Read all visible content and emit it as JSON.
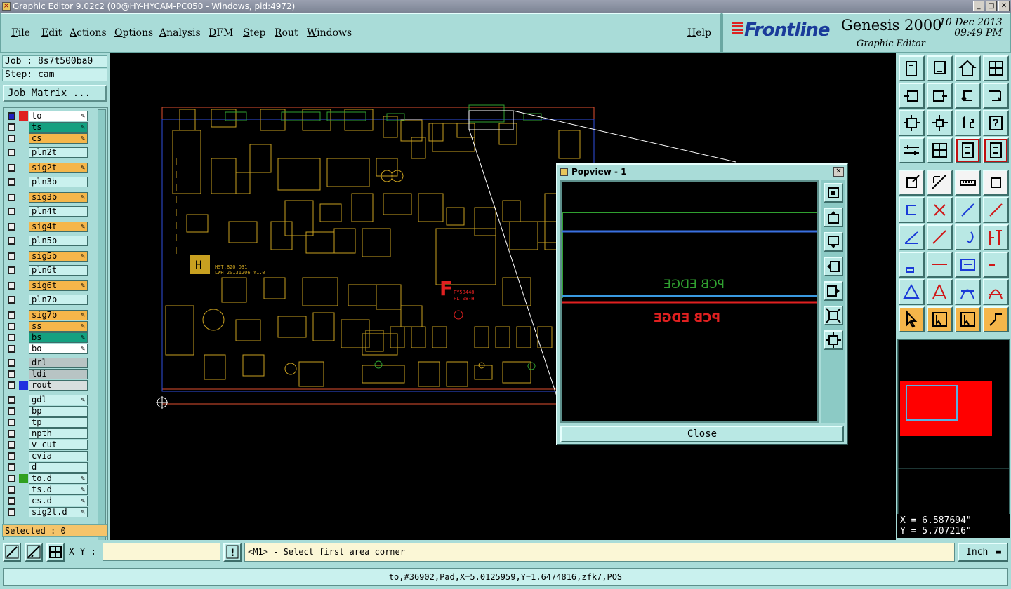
{
  "window": {
    "title": "Graphic Editor 9.02c2 (00@HY-HYCAM-PC050 - Windows, pid:4972)",
    "buttons": [
      "_",
      "□",
      "✕"
    ]
  },
  "menu": {
    "items": [
      "File",
      "Edit",
      "Actions",
      "Options",
      "Analysis",
      "DFM",
      "Step",
      "Rout",
      "Windows"
    ],
    "help": "Help"
  },
  "brand": {
    "logo": "Frontline",
    "product": "Genesis 2000",
    "date": "10 Dec 2013",
    "time": "09:49 PM",
    "subtitle": "Graphic Editor"
  },
  "left": {
    "job": "Job : 8s7t500ba0",
    "step": "Step: cam",
    "job_matrix": "Job Matrix ...",
    "selected": "Selected : 0",
    "layers": [
      {
        "name": "to",
        "bg": "#ffffff",
        "swatch": "#e02020",
        "edit": true,
        "box": "#2020c0"
      },
      {
        "name": "ts",
        "bg": "#14a080",
        "edit": true
      },
      {
        "name": "cs",
        "bg": "#f5b64a",
        "edit": true
      },
      {
        "name": "pln2t",
        "bg": "#c9f1ee",
        "edit": false
      },
      {
        "name": "sig2t",
        "bg": "#f5b64a",
        "edit": true
      },
      {
        "name": "pln3b",
        "bg": "#c9f1ee",
        "edit": false
      },
      {
        "name": "sig3b",
        "bg": "#f5b64a",
        "edit": true
      },
      {
        "name": "pln4t",
        "bg": "#c9f1ee",
        "edit": false
      },
      {
        "name": "sig4t",
        "bg": "#f5b64a",
        "edit": true
      },
      {
        "name": "pln5b",
        "bg": "#c9f1ee",
        "edit": false
      },
      {
        "name": "sig5b",
        "bg": "#f5b64a",
        "edit": true
      },
      {
        "name": "pln6t",
        "bg": "#c9f1ee",
        "edit": false
      },
      {
        "name": "sig6t",
        "bg": "#f5b64a",
        "edit": true
      },
      {
        "name": "pln7b",
        "bg": "#c9f1ee",
        "edit": false
      },
      {
        "name": "sig7b",
        "bg": "#f5b64a",
        "edit": true
      },
      {
        "name": "ss",
        "bg": "#f5b64a",
        "edit": true
      },
      {
        "name": "bs",
        "bg": "#14a080",
        "edit": true
      },
      {
        "name": "bo",
        "bg": "#ffffff",
        "edit": true
      },
      {
        "name": "drl",
        "bg": "#b8c4c4",
        "edit": false
      },
      {
        "name": "ldi",
        "bg": "#b8c4c4",
        "edit": false
      },
      {
        "name": "rout",
        "bg": "#d8dede",
        "swatch": "#2030e0",
        "edit": false
      },
      {
        "name": "gdl",
        "bg": "#c9f1ee",
        "edit": true
      },
      {
        "name": "bp",
        "bg": "#c9f1ee",
        "edit": false
      },
      {
        "name": "tp",
        "bg": "#c9f1ee",
        "edit": false
      },
      {
        "name": "npth",
        "bg": "#c9f1ee",
        "edit": false
      },
      {
        "name": "v-cut",
        "bg": "#c9f1ee",
        "edit": false
      },
      {
        "name": "cvia",
        "bg": "#c9f1ee",
        "edit": false
      },
      {
        "name": "d",
        "bg": "#c9f1ee",
        "edit": false
      },
      {
        "name": "to.d",
        "bg": "#c9f1ee",
        "swatch": "#30a020",
        "edit": true
      },
      {
        "name": "ts.d",
        "bg": "#c9f1ee",
        "edit": true
      },
      {
        "name": "cs.d",
        "bg": "#c9f1ee",
        "edit": true
      },
      {
        "name": "sig2t.d",
        "bg": "#c9f1ee",
        "edit": true
      }
    ]
  },
  "popview": {
    "title": "Popview - 1",
    "text_mirror": "PCB EDGE",
    "close": "Close"
  },
  "coords": {
    "x": "X = 6.587694\"",
    "y": "Y = 5.707216\""
  },
  "bottom": {
    "xy_label": "X Y :",
    "xy_value": "",
    "message": "<M1> - Select first area corner",
    "unit": "Inch"
  },
  "status": "to,#36902,Pad,X=5.0125959,Y=1.6474816,zfk7,POS",
  "board": {
    "chip_label_1": "PY58448",
    "chip_label_2": "PL.08-H",
    "silk_1": "HST.B20.D31",
    "silk_2": "LWH 20131206 Y1.0"
  }
}
